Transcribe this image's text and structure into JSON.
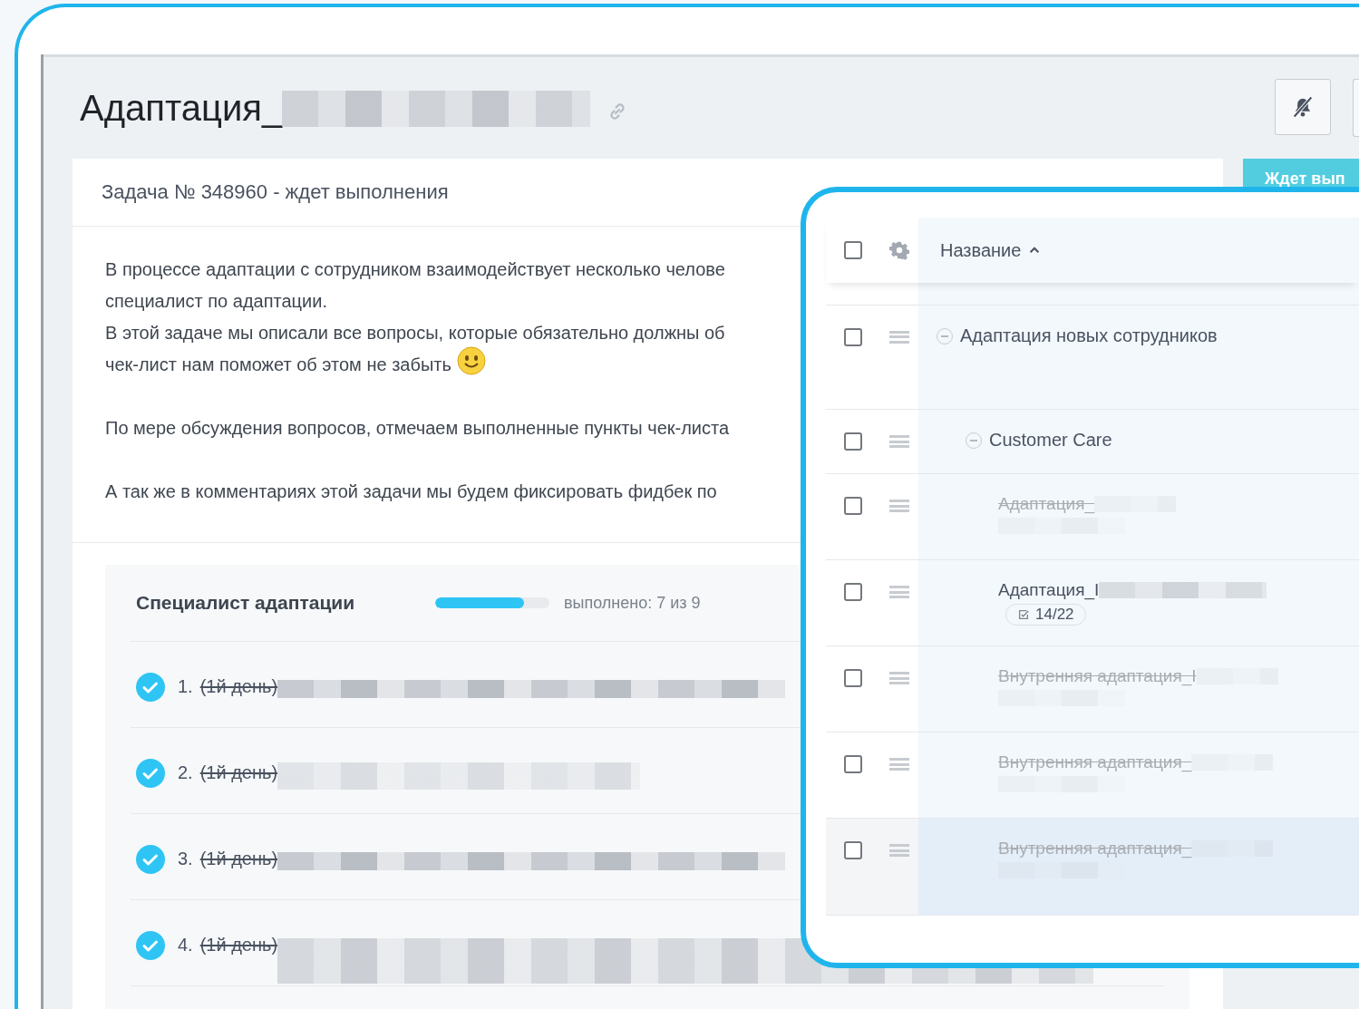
{
  "page": {
    "title": "Адаптация_",
    "title_redacted": true,
    "status_button": "Ждет вып"
  },
  "task": {
    "header": "Задача № 348960 - ждет выполнения",
    "paragraphs": [
      [
        {
          "kind": "text",
          "text": "В процессе адаптации с сотрудником взаимодействует несколько челове"
        },
        {
          "kind": "text",
          "text": "специалист по адаптации."
        },
        {
          "kind": "text",
          "text": "В этой задаче мы описали все вопросы, которые обязательно должны об"
        },
        {
          "kind": "text_emoji",
          "text": "чек-лист нам поможет об этом не забыть"
        }
      ],
      [
        {
          "kind": "text",
          "text": "По мере обсуждения вопросов, отмечаем выполненные пункты чек-листа"
        }
      ],
      [
        {
          "kind": "text",
          "text": "А так же в комментариях этой задачи мы будем фиксировать фидбек по"
        }
      ]
    ]
  },
  "checklist": {
    "title": "Специалист адаптации",
    "level": 0.78,
    "progress_text": "выполнено: 7 из 9",
    "items": [
      {
        "number": "1.",
        "text": "(1й день)",
        "checked": true
      },
      {
        "number": "2.",
        "text": "(1й день)",
        "checked": true
      },
      {
        "number": "3.",
        "text": "(1й день)",
        "checked": true
      },
      {
        "number": "4.",
        "text": "(1й день)",
        "checked": true
      }
    ]
  },
  "table": {
    "select_all_checked": false,
    "columns": [
      {
        "label": "Название",
        "sorted": true
      }
    ],
    "rows": [
      {
        "kind": "group",
        "text": "Адаптация новых сотрудников",
        "expanded": true,
        "checked": false,
        "children": [
          {
            "kind": "group",
            "text": "Customer Care",
            "expanded": true,
            "checked": false,
            "children": [
              {
                "kind": "task",
                "text": "Адаптация_",
                "done": true,
                "checked": false,
                "highlighted": false
              },
              {
                "kind": "task",
                "text": "Адаптация_I",
                "done": false,
                "checked": false,
                "highlighted": false,
                "badge": "14/22"
              },
              {
                "kind": "task",
                "text": "Внутренняя адаптация_I",
                "done": true,
                "checked": false,
                "highlighted": false
              },
              {
                "kind": "task",
                "text": "Внутренняя адаптация_",
                "done": true,
                "checked": false,
                "highlighted": false
              },
              {
                "kind": "task",
                "text": "Внутренняя адаптация_",
                "done": true,
                "checked": false,
                "highlighted": true
              }
            ]
          }
        ]
      }
    ]
  }
}
